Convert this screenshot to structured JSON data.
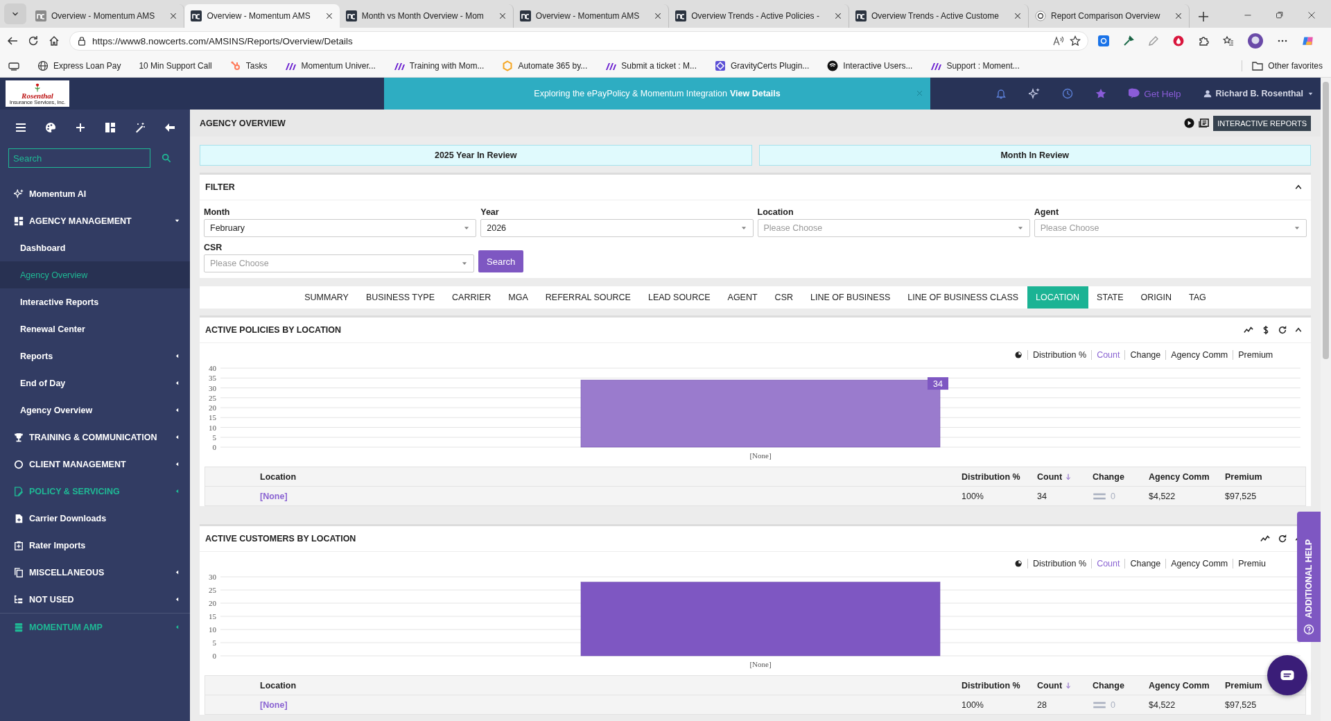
{
  "browser": {
    "tabs": [
      {
        "title": "Overview - Momentum AMS",
        "selected": false,
        "kind": "app"
      },
      {
        "title": "Overview - Momentum AMS",
        "selected": true,
        "kind": "app"
      },
      {
        "title": "Month vs Month Overview - Mom",
        "selected": false,
        "kind": "app"
      },
      {
        "title": "Overview - Momentum AMS",
        "selected": false,
        "kind": "app"
      },
      {
        "title": "Overview Trends - Active Policies -",
        "selected": false,
        "kind": "app"
      },
      {
        "title": "Overview Trends - Active Custome",
        "selected": false,
        "kind": "app"
      },
      {
        "title": "Report Comparison Overview",
        "selected": false,
        "kind": "chat"
      }
    ],
    "url": "https://www8.nowcerts.com/AMSINS/Reports/Overview/Details",
    "bookmarks": [
      {
        "label": "Express Loan Pay",
        "kind": "globe"
      },
      {
        "label": "10 Min Support Call",
        "kind": "blank"
      },
      {
        "label": "Tasks",
        "kind": "sprocket"
      },
      {
        "label": "Momentum Univer...",
        "kind": "momentum"
      },
      {
        "label": "Training with Mom...",
        "kind": "momentum"
      },
      {
        "label": "Automate 365 by...",
        "kind": "hexagon"
      },
      {
        "label": "Submit a ticket : M...",
        "kind": "momentum"
      },
      {
        "label": "GravityCerts Plugin...",
        "kind": "diamond"
      },
      {
        "label": "Interactive Users...",
        "kind": "circle"
      },
      {
        "label": "Support : Moment...",
        "kind": "momentum"
      }
    ],
    "other_favorites": "Other favorites"
  },
  "header": {
    "banner": {
      "text": "Exploring the ePayPolicy & Momentum Integration",
      "link": "View Details"
    },
    "help": "Get Help",
    "user": "Richard B. Rosenthal"
  },
  "sidebar": {
    "logo": {
      "name": "Rosenthal",
      "tagline": "Insurance Services, Inc."
    },
    "search": {
      "placeholder": "Search"
    },
    "items": [
      {
        "label": "Momentum AI",
        "kind": "section",
        "selected": false,
        "active": false
      },
      {
        "label": "AGENCY MANAGEMENT",
        "kind": "section",
        "selected": false,
        "active": false,
        "expanded": true
      },
      {
        "label": "Dashboard",
        "kind": "page",
        "selected": false,
        "active": false
      },
      {
        "label": "Agency Overview",
        "kind": "page",
        "selected": true,
        "active": false
      },
      {
        "label": "Interactive Reports",
        "kind": "page",
        "selected": false,
        "active": false
      },
      {
        "label": "Renewal Center",
        "kind": "page",
        "selected": false,
        "active": false
      },
      {
        "label": "Reports",
        "kind": "page",
        "selected": false,
        "active": false,
        "expanded": false
      },
      {
        "label": "End of Day",
        "kind": "page",
        "selected": false,
        "active": false,
        "expanded": false
      },
      {
        "label": "Agency Overview",
        "kind": "page",
        "selected": false,
        "active": false,
        "expanded": false
      },
      {
        "label": "TRAINING & COMMUNICATION",
        "kind": "section",
        "selected": false,
        "active": false,
        "expanded": false
      },
      {
        "label": "CLIENT MANAGEMENT",
        "kind": "section",
        "selected": false,
        "active": false,
        "expanded": false
      },
      {
        "label": "POLICY & SERVICING",
        "kind": "section",
        "selected": false,
        "active": true,
        "expanded": false
      },
      {
        "label": "Carrier Downloads",
        "kind": "section",
        "selected": false,
        "active": false
      },
      {
        "label": "Rater Imports",
        "kind": "section",
        "selected": false,
        "active": false
      },
      {
        "label": "MISCELLANEOUS",
        "kind": "section",
        "selected": false,
        "active": false,
        "expanded": false
      },
      {
        "label": "NOT USED",
        "kind": "section",
        "selected": false,
        "active": false,
        "expanded": false
      },
      {
        "label": "MOMENTUM AMP",
        "kind": "section",
        "selected": false,
        "active": true,
        "expanded": false
      }
    ]
  },
  "page": {
    "title": "AGENCY OVERVIEW",
    "action": "INTERACTIVE REPORTS",
    "reviews": [
      "2025 Year In Review",
      "Month In Review"
    ]
  },
  "filter": {
    "title": "FILTER",
    "expanded": true,
    "fields": [
      {
        "label": "Month",
        "value": "February"
      },
      {
        "label": "Year",
        "value": "2026"
      },
      {
        "label": "Location",
        "placeholder": "Please Choose"
      },
      {
        "label": "Agent",
        "placeholder": "Please Choose"
      },
      {
        "label": "CSR",
        "placeholder": "Please Choose"
      }
    ],
    "button": "Search"
  },
  "report_tabs": [
    {
      "label": "SUMMARY",
      "selected": false
    },
    {
      "label": "BUSINESS TYPE",
      "selected": false
    },
    {
      "label": "CARRIER",
      "selected": false
    },
    {
      "label": "MGA",
      "selected": false
    },
    {
      "label": "REFERRAL SOURCE",
      "selected": false
    },
    {
      "label": "LEAD SOURCE",
      "selected": false
    },
    {
      "label": "AGENT",
      "selected": false
    },
    {
      "label": "CSR",
      "selected": false
    },
    {
      "label": "LINE OF BUSINESS",
      "selected": false
    },
    {
      "label": "LINE OF BUSINESS CLASS",
      "selected": false
    },
    {
      "label": "LOCATION",
      "selected": true
    },
    {
      "label": "STATE",
      "selected": false
    },
    {
      "label": "ORIGIN",
      "selected": false
    },
    {
      "label": "TAG",
      "selected": false
    }
  ],
  "panels": [
    {
      "title": "ACTIVE POLICIES BY LOCATION",
      "dollar_tool": true,
      "options": [
        {
          "label": "Distribution %",
          "selected": false
        },
        {
          "label": "Count",
          "selected": true
        },
        {
          "label": "Change",
          "selected": false
        },
        {
          "label": "Agency Comm",
          "selected": false
        },
        {
          "label": "Premium",
          "selected": false
        }
      ],
      "chart_data": {
        "type": "bar",
        "categories": [
          "[None]"
        ],
        "series": [
          {
            "color": "#9a7bcd",
            "values": [
              34
            ]
          }
        ],
        "ylim": [
          0,
          40
        ],
        "yticks": [
          0,
          5,
          10,
          15,
          20,
          25,
          30,
          35,
          40
        ],
        "grid": true,
        "data_labels": true
      },
      "table": {
        "columns": [
          {
            "label": "Location",
            "kind": "link",
            "sorted": false
          },
          {
            "label": "Distribution %",
            "kind": "text",
            "sorted": false
          },
          {
            "label": "Count",
            "kind": "text",
            "sorted": true
          },
          {
            "label": "Change",
            "kind": "change",
            "sorted": false
          },
          {
            "label": "Agency Comm",
            "kind": "text",
            "sorted": false
          },
          {
            "label": "Premium",
            "kind": "text",
            "sorted": false
          }
        ],
        "rows": [
          [
            "[None]",
            "100%",
            "34",
            "0",
            "$4,522",
            "$97,525"
          ]
        ]
      }
    },
    {
      "title": "ACTIVE CUSTOMERS BY LOCATION",
      "dollar_tool": false,
      "options": [
        {
          "label": "Distribution %",
          "selected": false
        },
        {
          "label": "Count",
          "selected": true
        },
        {
          "label": "Change",
          "selected": false
        },
        {
          "label": "Agency Comm",
          "selected": false
        },
        {
          "label": "Premiu",
          "selected": false
        }
      ],
      "chart_data": {
        "type": "bar",
        "categories": [
          "[None]"
        ],
        "series": [
          {
            "color": "#7e57c2",
            "values": [
              28
            ]
          }
        ],
        "ylim": [
          0,
          30
        ],
        "yticks": [
          0,
          5,
          10,
          15,
          20,
          25,
          30
        ],
        "grid": true,
        "data_labels": false
      },
      "table": {
        "columns": [
          {
            "label": "Location",
            "kind": "link",
            "sorted": false
          },
          {
            "label": "Distribution %",
            "kind": "text",
            "sorted": false
          },
          {
            "label": "Count",
            "kind": "text",
            "sorted": true
          },
          {
            "label": "Change",
            "kind": "change",
            "sorted": false
          },
          {
            "label": "Agency Comm",
            "kind": "text",
            "sorted": false
          },
          {
            "label": "Premium",
            "kind": "text",
            "sorted": false
          }
        ],
        "rows": [
          [
            "[None]",
            "100%",
            "28",
            "0",
            "$4,522",
            "$97,525"
          ]
        ]
      }
    }
  ],
  "additional_help": "ADDITIONAL HELP"
}
